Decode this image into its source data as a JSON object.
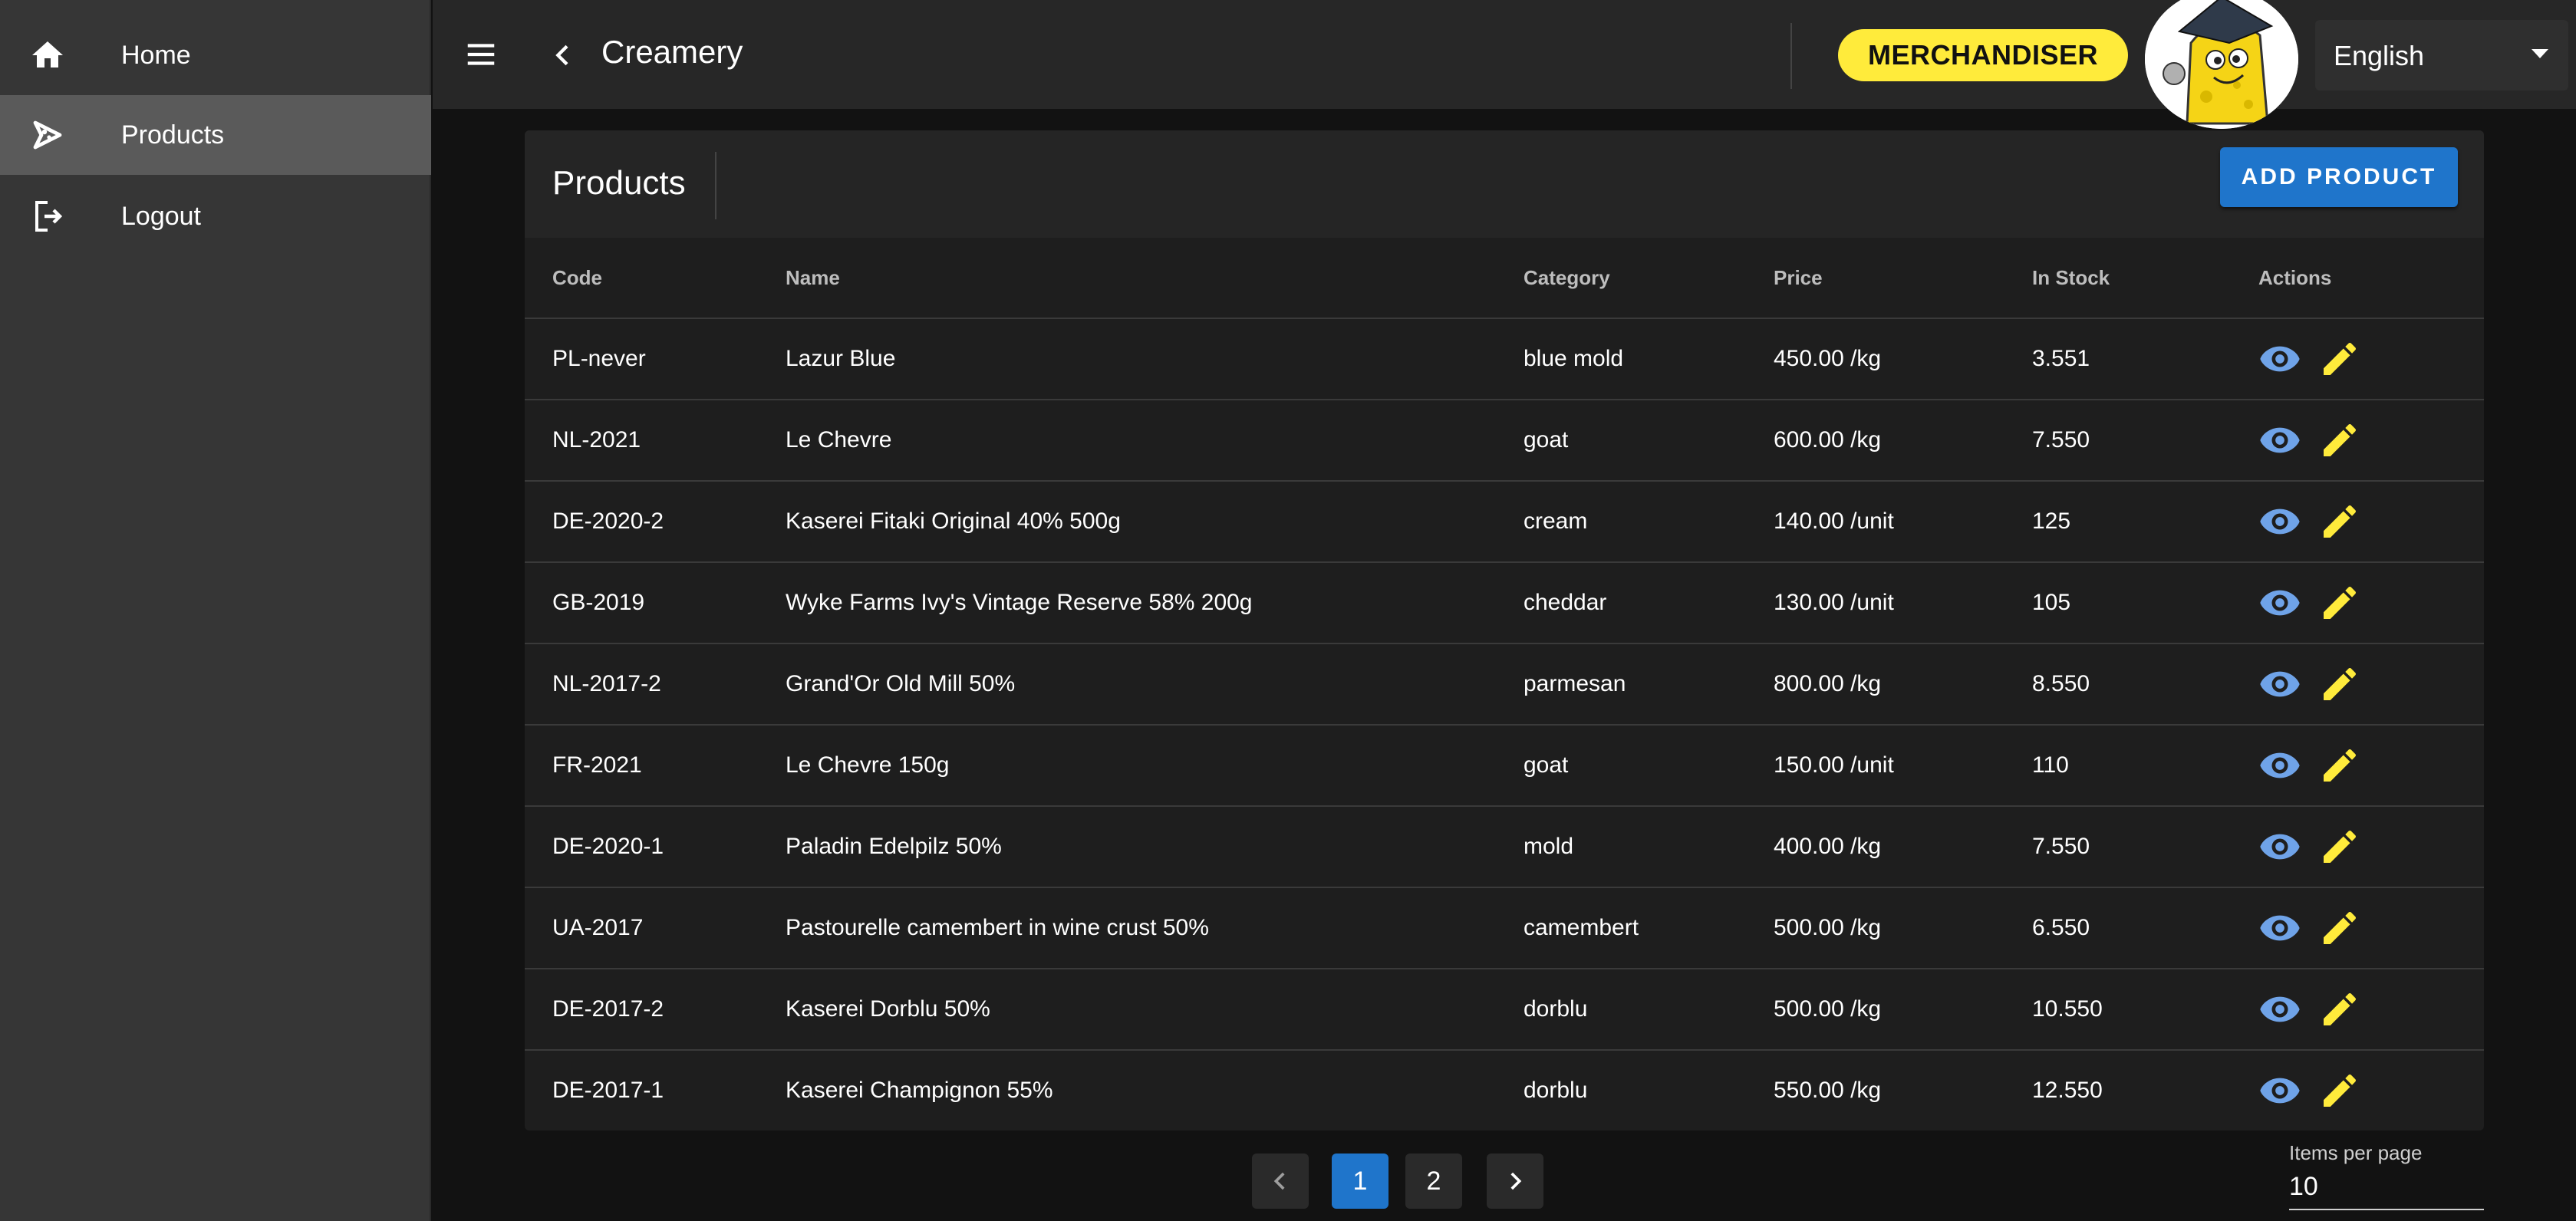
{
  "sidebar": {
    "items": [
      {
        "label": "Home",
        "icon": "home-icon"
      },
      {
        "label": "Products",
        "icon": "products-icon"
      },
      {
        "label": "Logout",
        "icon": "logout-icon"
      }
    ]
  },
  "header": {
    "title": "Creamery",
    "role_badge": "MERCHANDISER",
    "language": "English"
  },
  "products": {
    "title": "Products",
    "add_button": "ADD PRODUCT",
    "columns": [
      "Code",
      "Name",
      "Category",
      "Price",
      "In Stock",
      "Actions"
    ],
    "rows": [
      {
        "code": "PL-never",
        "name": "Lazur Blue",
        "category": "blue mold",
        "price": "450.00 /kg",
        "stock": "3.551"
      },
      {
        "code": "NL-2021",
        "name": "Le Chevre",
        "category": "goat",
        "price": "600.00 /kg",
        "stock": "7.550"
      },
      {
        "code": "DE-2020-2",
        "name": "Kaserei Fitaki Original 40% 500g",
        "category": "cream",
        "price": "140.00 /unit",
        "stock": "125"
      },
      {
        "code": "GB-2019",
        "name": "Wyke Farms Ivy's Vintage Reserve 58% 200g",
        "category": "cheddar",
        "price": "130.00 /unit",
        "stock": "105"
      },
      {
        "code": "NL-2017-2",
        "name": "Grand'Or Old Mill 50%",
        "category": "parmesan",
        "price": "800.00 /kg",
        "stock": "8.550"
      },
      {
        "code": "FR-2021",
        "name": "Le Chevre 150g",
        "category": "goat",
        "price": "150.00 /unit",
        "stock": "110"
      },
      {
        "code": "DE-2020-1",
        "name": "Paladin Edelpilz 50%",
        "category": "mold",
        "price": "400.00 /kg",
        "stock": "7.550"
      },
      {
        "code": "UA-2017",
        "name": "Pastourelle camembert in wine crust 50%",
        "category": "camembert",
        "price": "500.00 /kg",
        "stock": "6.550"
      },
      {
        "code": "DE-2017-2",
        "name": "Kaserei Dorblu 50%",
        "category": "dorblu",
        "price": "500.00 /kg",
        "stock": "10.550"
      },
      {
        "code": "DE-2017-1",
        "name": "Kaserei Champignon 55%",
        "category": "dorblu",
        "price": "550.00 /kg",
        "stock": "12.550"
      }
    ]
  },
  "pagination": {
    "pages": [
      "1",
      "2"
    ],
    "current": "1",
    "items_per_page_label": "Items per page",
    "items_per_page": "10"
  },
  "colors": {
    "accent": "#1f75cb",
    "badge": "#ffeb3b",
    "view_icon": "#6fa3e8",
    "edit_icon": "#ffeb3b"
  }
}
